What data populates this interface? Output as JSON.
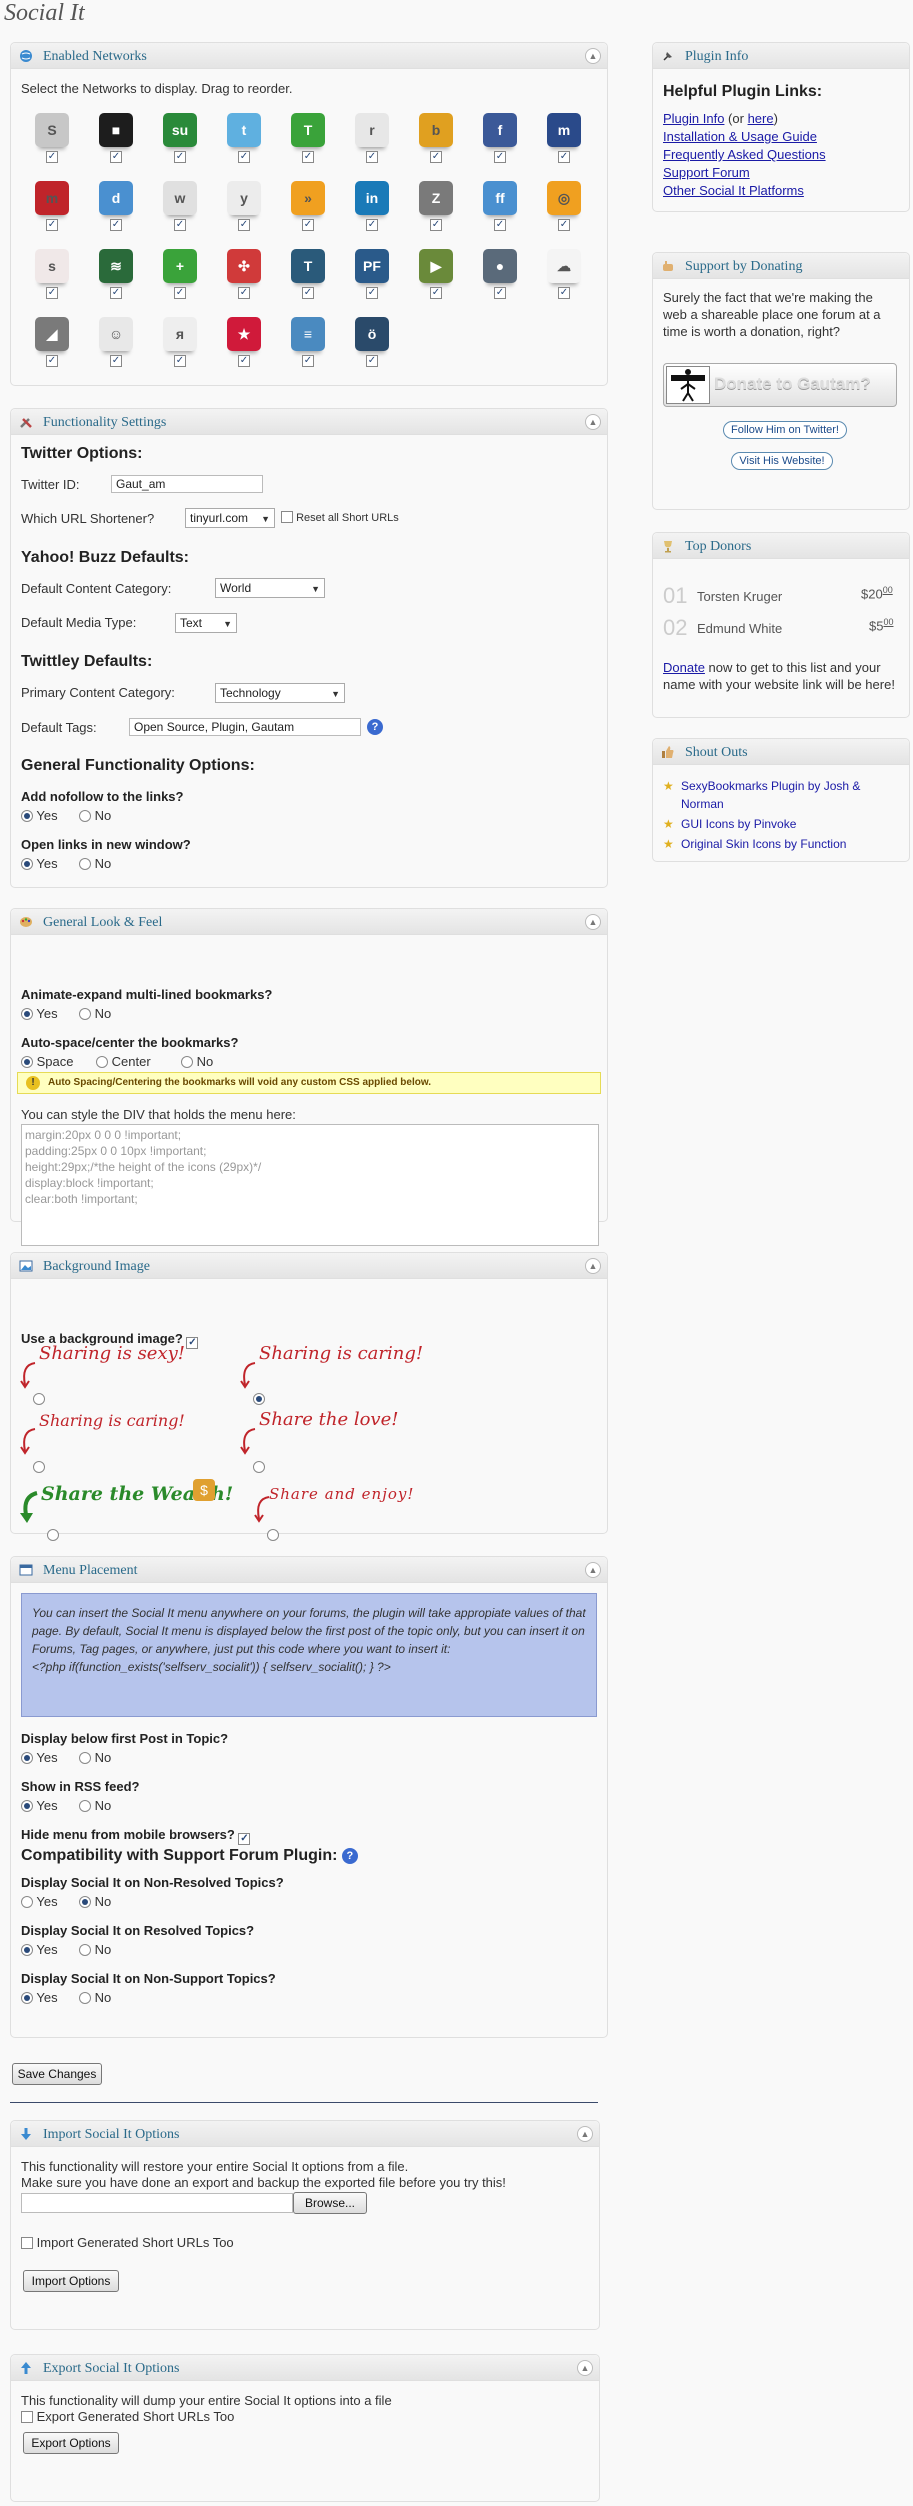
{
  "page": {
    "title": "Social It"
  },
  "networks_box": {
    "title": "Enabled Networks",
    "intro": "Select the Networks to display. Drag to reorder.",
    "networks": [
      {
        "name": "scriptstyle",
        "glyph": "S",
        "color": "#c7c7c7"
      },
      {
        "name": "blinklist",
        "glyph": "■",
        "color": "#1d1d1d"
      },
      {
        "name": "stumbleupon",
        "glyph": "su",
        "color": "#2a8a3a"
      },
      {
        "name": "twitter",
        "glyph": "t",
        "color": "#5fb0e0"
      },
      {
        "name": "technorati",
        "glyph": "T",
        "color": "#3aa33a"
      },
      {
        "name": "reddit",
        "glyph": "r",
        "color": "#e7e7e7"
      },
      {
        "name": "designbump",
        "glyph": "b",
        "color": "#e0a020"
      },
      {
        "name": "facebook",
        "glyph": "f",
        "color": "#3b5998"
      },
      {
        "name": "myspace",
        "glyph": "m",
        "color": "#2a4a8a"
      },
      {
        "name": "mixx",
        "glyph": "m",
        "color": "#c0242a"
      },
      {
        "name": "dzone",
        "glyph": "d",
        "color": "#4a90d0"
      },
      {
        "name": "mister-wong",
        "glyph": "w",
        "color": "#e0e0e0"
      },
      {
        "name": "yahoo",
        "glyph": "y",
        "color": "#ececec"
      },
      {
        "name": "rss",
        "glyph": "»",
        "color": "#f0a020"
      },
      {
        "name": "linkedin",
        "glyph": "in",
        "color": "#1a7ab8"
      },
      {
        "name": "blogmarks",
        "glyph": "Z",
        "color": "#7a7a7a"
      },
      {
        "name": "friendfeed",
        "glyph": "ff",
        "color": "#4a90d0"
      },
      {
        "name": "propeller",
        "glyph": "◎",
        "color": "#f0a020"
      },
      {
        "name": "scribd",
        "glyph": "s",
        "color": "#f0e8e8"
      },
      {
        "name": "ekudos",
        "glyph": "≋",
        "color": "#2a6a3a"
      },
      {
        "name": "misterwong",
        "glyph": "+",
        "color": "#3aa33a"
      },
      {
        "name": "netvibes",
        "glyph": "✣",
        "color": "#d03a3a"
      },
      {
        "name": "tumblr",
        "glyph": "T",
        "color": "#2a5a7a"
      },
      {
        "name": "yahoo-buzz",
        "glyph": "PF",
        "color": "#2a5a8a"
      },
      {
        "name": "jumptags",
        "glyph": "▶",
        "color": "#6a8a3a"
      },
      {
        "name": "plurk",
        "glyph": "●",
        "color": "#5a6a7a"
      },
      {
        "name": "diigo",
        "glyph": "☁",
        "color": "#f4f4f4"
      },
      {
        "name": "slashdot",
        "glyph": "◢",
        "color": "#7a7a7a"
      },
      {
        "name": "hyves",
        "glyph": "☺",
        "color": "#e8e8e8"
      },
      {
        "name": "yandex",
        "glyph": "я",
        "color": "#eeeeee"
      },
      {
        "name": "misterwong-star",
        "glyph": "★",
        "color": "#d01a3a"
      },
      {
        "name": "blogger",
        "glyph": "≡",
        "color": "#4a8ac0"
      },
      {
        "name": "orkut",
        "glyph": "ö",
        "color": "#2a4a6a"
      }
    ]
  },
  "functionality": {
    "title": "Functionality Settings",
    "twitter_heading": "Twitter Options:",
    "twitter_id_label": "Twitter ID:",
    "twitter_id_value": "Gaut_am",
    "shortener_label": "Which URL Shortener?",
    "shortener_value": "tinyurl.com",
    "reset_label": "Reset all Short URLs",
    "buzz_heading": "Yahoo! Buzz Defaults:",
    "content_cat_label": "Default Content Category:",
    "content_cat_value": "World",
    "media_type_label": "Default Media Type:",
    "media_type_value": "Text",
    "twittley_heading": "Twittley Defaults:",
    "primary_cat_label": "Primary Content Category:",
    "primary_cat_value": "Technology",
    "tags_label": "Default Tags:",
    "tags_value": "Open Source, Plugin, Gautam",
    "general_heading": "General Functionality Options:",
    "nofollow_label": "Add nofollow to the links?",
    "newwindow_label": "Open links in new window?",
    "yes": "Yes",
    "no": "No"
  },
  "look": {
    "title": "General Look & Feel",
    "animate_label": "Animate-expand multi-lined bookmarks?",
    "autospace_label": "Auto-space/center the bookmarks?",
    "space": "Space",
    "center": "Center",
    "yes": "Yes",
    "no": "No",
    "warning": "Auto Spacing/Centering the bookmarks will void any custom CSS applied below.",
    "style_label": "You can style the DIV that holds the menu here:",
    "css_lines": [
      "margin:20px 0 0 0 !important;",
      "padding:25px 0 0 10px !important;",
      "height:29px;/*the height of the icons (29px)*/",
      "display:block !important;",
      "clear:both !important;"
    ]
  },
  "background": {
    "title": "Background Image",
    "use_label": "Use a background image?",
    "options": [
      "Sharing is sexy!",
      "Sharing is caring!",
      "Sharing is caring!",
      "Share the love!",
      "Share the Wealth!",
      "Share and enjoy!"
    ]
  },
  "placement": {
    "title": "Menu Placement",
    "info": "You can insert the Social It menu anywhere on your forums, the plugin will take appropiate values of that page. By default, Social It menu is displayed below the first post of the topic only, but you can insert it on Forums, Tag pages, or anywhere, just put this code where you want to insert it:",
    "code": "<?php if(function_exists('selfserv_socialit')) { selfserv_socialit(); } ?>",
    "below_first_label": "Display below first Post in Topic?",
    "rss_label": "Show in RSS feed?",
    "mobile_label": "Hide menu from mobile browsers?",
    "compat_heading": "Compatibility with Support Forum Plugin:",
    "nonresolved_label": "Display Social It on Non-Resolved Topics?",
    "resolved_label": "Display Social It on Resolved Topics?",
    "nonsupport_label": "Display Social It on Non-Support Topics?",
    "yes": "Yes",
    "no": "No"
  },
  "save_button": "Save Changes",
  "import": {
    "title": "Import Social It Options",
    "line1": "This functionality will restore your entire Social It options from a file.",
    "line2": "Make sure you have done an export and backup the exported file before you try this!",
    "browse": "Browse...",
    "checkbox_label": "Import Generated Short URLs Too",
    "button": "Import Options"
  },
  "export": {
    "title": "Export Social It Options",
    "line1": "This functionality will dump your entire Social It options into a file",
    "checkbox_label": "Export Generated Short URLs Too",
    "button": "Export Options"
  },
  "plugin_info": {
    "title": "Plugin Info",
    "heading": "Helpful Plugin Links:",
    "link1a": "Plugin Info",
    "link1_mid": " (or ",
    "link1b": "here",
    "link1_end": ")",
    "link2": "Installation & Usage Guide",
    "link3": "Frequently Asked Questions",
    "link4": "Support Forum",
    "link5": "Other Social It Platforms"
  },
  "donating": {
    "title": "Support by Donating",
    "text": "Surely the fact that we're making the web a shareable place one forum at a time is worth a donation, right?",
    "donate_button": "Donate to Gautam?",
    "follow_button": "Follow Him on Twitter!",
    "visit_button": "Visit His Website!"
  },
  "top_donors": {
    "title": "Top Donors",
    "donors": [
      {
        "rank": "01",
        "name": "Torsten Kruger",
        "amount": "$20",
        "cents": "00"
      },
      {
        "rank": "02",
        "name": "Edmund White",
        "amount": "$5",
        "cents": "00"
      }
    ],
    "cta_link": "Donate",
    "cta_text": " now to get to this list and your name with your website link will be here!"
  },
  "shout_outs": {
    "title": "Shout Outs",
    "items": [
      "SexyBookmarks Plugin by Josh & Norman",
      "GUI Icons by Pinvoke",
      "Original Skin Icons by Function"
    ]
  },
  "colors": {
    "accent": "#2a6a8a",
    "link": "#1a1aa6",
    "warning_bg": "#ffffc0",
    "info_bg": "#b6c4ec"
  }
}
